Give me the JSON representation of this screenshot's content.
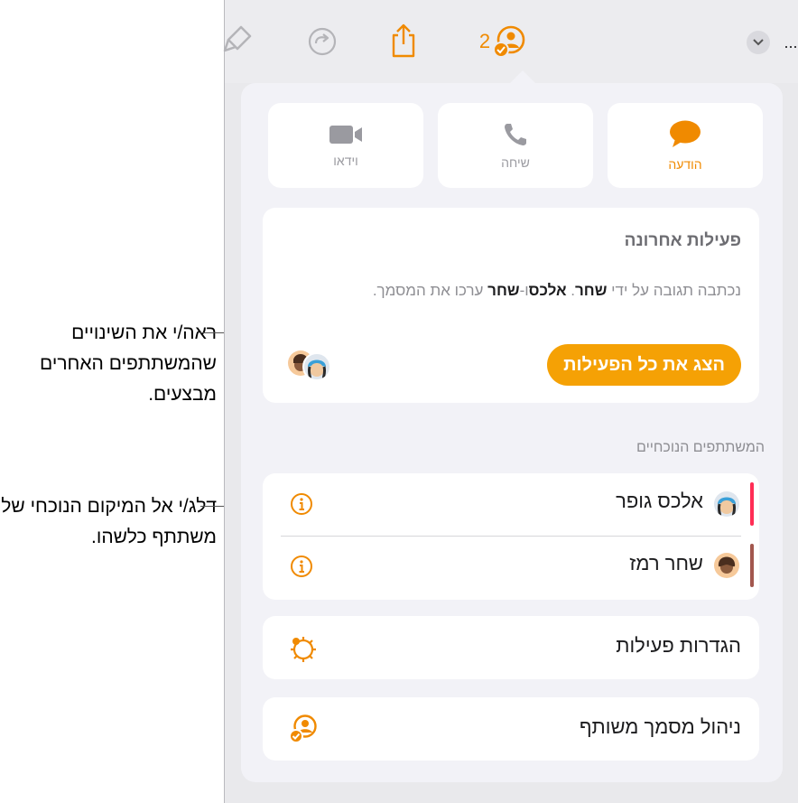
{
  "toolbar": {
    "collab_count": "2",
    "more_dots": "..."
  },
  "communication": {
    "message_label": "הודעה",
    "call_label": "שיחה",
    "video_label": "וידאו"
  },
  "activity": {
    "title": "פעילות אחרונה",
    "text_prefix": "נכתבה תגובה על ידי",
    "name_a": "שחר",
    "name_b": "אלכס",
    "and": "ו-",
    "name_c": "שחר",
    "text_suffix": "ערכו את המסמך.",
    "show_all_label": "הצג את כל הפעילות"
  },
  "participants": {
    "section_label": "המשתתפים הנוכחיים",
    "items": [
      {
        "name": "אלכס גופר",
        "color": "#ff2d55"
      },
      {
        "name": "שחר רמז",
        "color": "#a2574e"
      }
    ]
  },
  "settings": {
    "activity_settings_label": "הגדרות פעילות",
    "manage_label": "ניהול מסמך משותף"
  },
  "callouts": {
    "top": "ראה/י את השינויים שהמשתתפים האחרים מבצעים.",
    "bottom": "דלג/י אל המיקום הנוכחי של משתתף כלשהו."
  },
  "colors": {
    "accent": "#f5a105",
    "icon_orange": "#f08a00"
  }
}
